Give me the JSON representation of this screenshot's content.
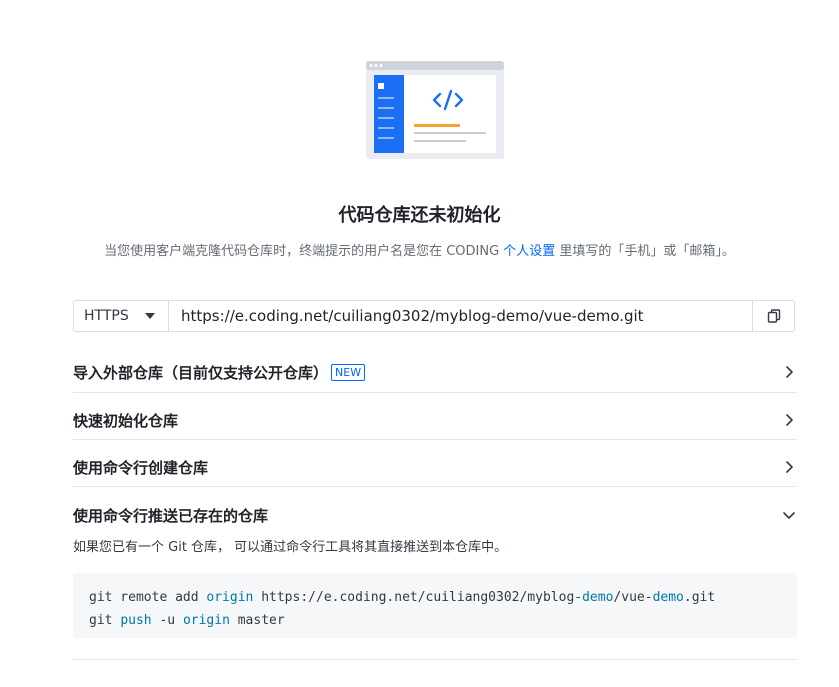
{
  "empty_state": {
    "title": "代码仓库还未初始化",
    "subtitle_before": "当您使用客户端克隆代码仓库时，终端提示的用户名是您在 CODING ",
    "subtitle_link": "个人设置",
    "subtitle_after": " 里填写的「手机」或「邮箱」。"
  },
  "clone": {
    "protocol": "HTTPS",
    "url": "https://e.coding.net/cuiliang0302/myblog-demo/vue-demo.git"
  },
  "sections": [
    {
      "label": "导入外部仓库（目前仅支持公开仓库）",
      "badge": "NEW",
      "expanded": false
    },
    {
      "label": "快速初始化仓库",
      "expanded": false
    },
    {
      "label": "使用命令行创建仓库",
      "expanded": false
    },
    {
      "label": "使用命令行推送已存在的仓库",
      "expanded": true
    }
  ],
  "push_existing": {
    "description": "如果您已有一个 Git 仓库， 可以通过命令行工具将其直接推送到本仓库中。",
    "line1": {
      "p1": "git remote add ",
      "k1": "origin",
      "p2": " https://e.coding.net/cuiliang0302/myblog-",
      "k2": "demo",
      "p3": "/vue-",
      "k3": "demo",
      "p4": ".git"
    },
    "line2": {
      "p1": "git ",
      "k1": "push",
      "p2": " -u ",
      "k2": "origin",
      "p3": " master"
    }
  },
  "colors": {
    "accent": "#0066ff",
    "keyword": "#0077aa",
    "code_bg": "#f5f7f9",
    "illustration_orange": "#f5a033"
  },
  "icons": {
    "copy": "copy-icon",
    "chevron_right": "chevron-right-icon",
    "chevron_down": "chevron-down-icon",
    "caret": "caret-down-icon"
  }
}
